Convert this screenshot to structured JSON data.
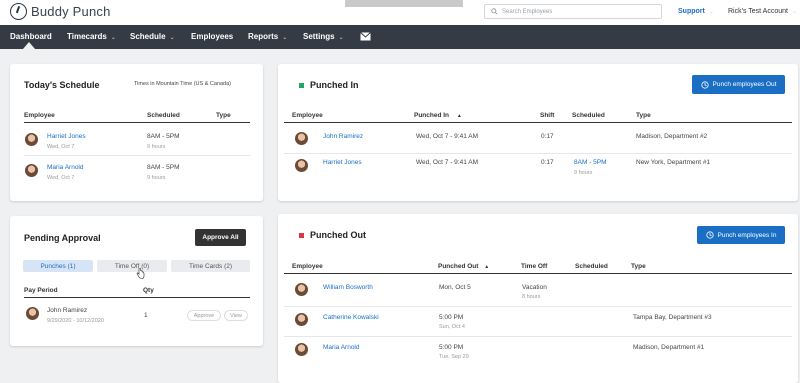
{
  "app": {
    "logo_text": "Buddy Punch"
  },
  "topbar": {
    "search_placeholder": "Search Employees",
    "support": "Support",
    "account": "Rick's Test Account"
  },
  "nav": {
    "items": [
      {
        "label": "Dashboard"
      },
      {
        "label": "Timecards"
      },
      {
        "label": "Schedule"
      },
      {
        "label": "Employees"
      },
      {
        "label": "Reports"
      },
      {
        "label": "Settings"
      }
    ],
    "caret": "⌄"
  },
  "schedule": {
    "title": "Today's Schedule",
    "timezone": "Times in Mountain Time (US & Canada)",
    "headers": {
      "employee": "Employee",
      "scheduled": "Scheduled",
      "type": "Type"
    },
    "rows": [
      {
        "name": "Harriet Jones",
        "date": "Wed, Oct 7",
        "time": "8AM - 5PM",
        "hours": "9 hours"
      },
      {
        "name": "Maria Arnold",
        "date": "Wed, Oct 7",
        "time": "8AM - 5PM",
        "hours": "9 hours"
      }
    ]
  },
  "punched_in": {
    "title": "Punched In",
    "button": "Punch employees Out",
    "indicator_color": "#27a567",
    "headers": {
      "employee": "Employee",
      "punched_in": "Punched In",
      "sort": "▲",
      "shift": "Shift",
      "scheduled": "Scheduled",
      "type": "Type"
    },
    "rows": [
      {
        "name": "John Ramirez",
        "punched": "Wed, Oct 7 - 9:41 AM",
        "shift": "0:17",
        "scheduled": "",
        "hours": "",
        "type": "Madison, Department #2"
      },
      {
        "name": "Harriet Jones",
        "punched": "Wed, Oct 7 - 9:41 AM",
        "shift": "0:17",
        "scheduled": "8AM - 5PM",
        "hours": "9 hours",
        "type": "New York, Department #1"
      }
    ]
  },
  "pending": {
    "title": "Pending Approval",
    "approve_all": "Approve All",
    "tabs": [
      {
        "label": "Punches (1)"
      },
      {
        "label": "Time Off (0)"
      },
      {
        "label": "Time Cards (2)"
      }
    ],
    "headers": {
      "period": "Pay Period",
      "qty": "Qty"
    },
    "rows": [
      {
        "name": "John Ramirez",
        "period": "9/29/2020 - 10/12/2020",
        "qty": "1",
        "approve": "Approve",
        "view": "View"
      }
    ]
  },
  "punched_out": {
    "title": "Punched Out",
    "button": "Punch employees In",
    "indicator_color": "#d9364a",
    "headers": {
      "employee": "Employee",
      "punched_out": "Punched Out",
      "sort": "▲",
      "time_off": "Time Off",
      "scheduled": "Scheduled",
      "type": "Type"
    },
    "rows": [
      {
        "name": "William Bosworth",
        "time": "Mon, Oct 5",
        "date": "",
        "time_off": "Vacation",
        "time_off_hours": "8 hours",
        "type": ""
      },
      {
        "name": "Catherine Kowalski",
        "time": "5:00 PM",
        "date": "Sun, Oct 4",
        "time_off": "",
        "time_off_hours": "",
        "type": "Tampa Bay, Department #3"
      },
      {
        "name": "Maria Arnold",
        "time": "5:00 PM",
        "date": "Tue, Sep 29",
        "time_off": "",
        "time_off_hours": "",
        "type": "Madison, Department #1"
      }
    ]
  },
  "colors": {
    "accent": "#1a6fc4",
    "nav_bg": "#343b45"
  }
}
